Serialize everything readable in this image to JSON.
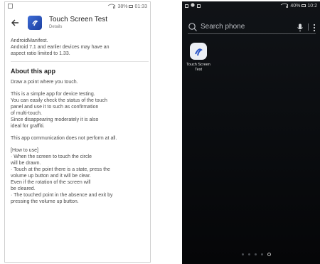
{
  "left_status": {
    "left_icon": "image-icon",
    "battery": "38%",
    "time": "01:33",
    "signal": "wifi-signal-icon"
  },
  "appbar": {
    "title": "Touch Screen Test",
    "subtitle": "Details",
    "back_icon": "arrow-back-icon",
    "app_icon": "touch-app-icon"
  },
  "details": {
    "intro": "AndroidManifest.\nAndroid 7.1 and earlier devices may have an\naspect ratio limited to 1.33.",
    "section_title": "About this app",
    "p1": "Draw a point where you touch.",
    "p2": "This is a simple app for device testing.\nYou can easily check the status of the touch\npanel and use it to such as confirmation\nof multi-touch.\nSince disappearing moderately it is also\nideal for graffiti.",
    "p3": "This app communication does not perform at all.",
    "p4": "[How to use]\n· When the screen to touch the circle\nwill be drawn.\n· Touch at the point there is a state, press the\nvolume up button and it will be clear.\n Even if the rotation of the screen will\nbe cleared.\n· The touched point in the absence and exit by\npressing the volume up button."
  },
  "right_status": {
    "battery": "40%",
    "time": "10:2"
  },
  "search": {
    "placeholder": "Search phone",
    "icon": "search-icon",
    "mic": "mic-icon",
    "more": "more-vert-icon"
  },
  "home_app": {
    "label": "Touch Screen Test",
    "icon": "touch-app-icon"
  },
  "colors": {
    "accent": "#2b56c7",
    "dark_bg": "#0b0d10"
  }
}
